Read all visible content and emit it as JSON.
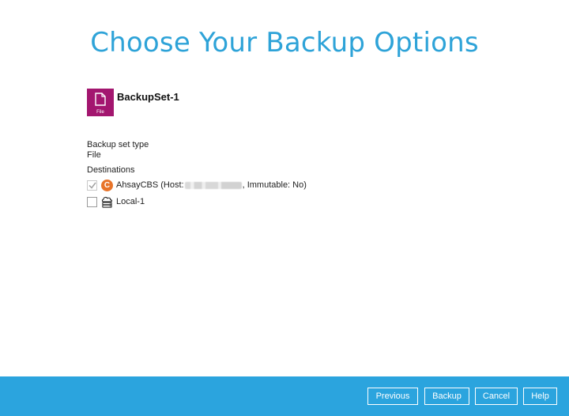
{
  "page": {
    "title": "Choose Your Backup Options"
  },
  "backup_set": {
    "name": "BackupSet-1",
    "icon": "file-icon",
    "icon_label": "File",
    "icon_color": "#a3166f"
  },
  "details": {
    "type_label": "Backup set type",
    "type_value": "File",
    "destinations_label": "Destinations"
  },
  "destinations": [
    {
      "name_prefix": "AhsayCBS (Host: ",
      "host_blurred": true,
      "name_suffix": ", Immutable: No)",
      "checked": true,
      "disabled": true,
      "icon": "ahsaycbs-icon",
      "icon_glyph": "C",
      "icon_color": "#e8742a"
    },
    {
      "name": "Local-1",
      "checked": false,
      "disabled": false,
      "icon": "local-storage-icon"
    }
  ],
  "footer": {
    "previous_label": "Previous",
    "backup_label": "Backup",
    "cancel_label": "Cancel",
    "help_label": "Help",
    "bar_color": "#2ba4de"
  },
  "theme": {
    "title_color": "#2ea3d8"
  }
}
